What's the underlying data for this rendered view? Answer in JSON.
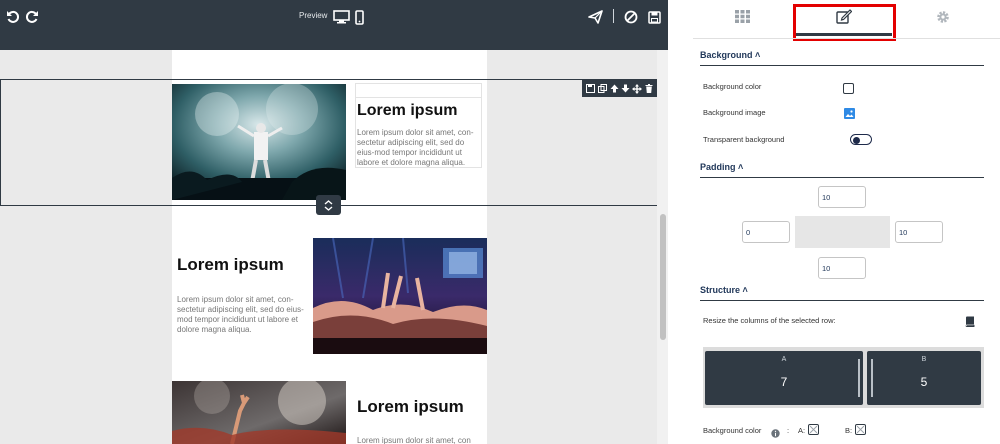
{
  "toolbar": {
    "preview_label": "Preview",
    "icons": [
      "undo-icon",
      "redo-icon",
      "desktop-icon",
      "mobile-icon",
      "send-icon",
      "block-icon",
      "save-icon"
    ]
  },
  "row_toolbar": {
    "icons": [
      "save-icon",
      "copy-icon",
      "arrow-up-icon",
      "arrow-down-icon",
      "move-icon",
      "trash-icon"
    ]
  },
  "content": {
    "blocks": [
      {
        "title": "Lorem ipsum",
        "body": "Lorem ipsum dolor sit amet, con-sectetur adipiscing elit, sed do eius-mod tempor incididunt ut labore et dolore magna aliqua."
      },
      {
        "title": "Lorem ipsum",
        "body": "Lorem ipsum dolor sit amet, con-sectetur adipiscing elit, sed do eius-mod tempor incididunt ut labore et dolore magna aliqua."
      },
      {
        "title": "Lorem ipsum",
        "body": "Lorem ipsum dolor sit amet, con"
      }
    ]
  },
  "panel": {
    "tabs": [
      "blocks-tab",
      "edit-tab",
      "settings-tab"
    ],
    "active_tab": "edit-tab",
    "background": {
      "title": "Background",
      "color_label": "Background color",
      "image_label": "Background image",
      "transparent_label": "Transparent background",
      "transparent_on": true
    },
    "padding": {
      "title": "Padding",
      "top": "10",
      "left": "0",
      "right": "10",
      "bottom": "10"
    },
    "structure": {
      "title": "Structure",
      "resize_label": "Resize the columns of the selected row:",
      "columns": [
        {
          "letter": "A",
          "value": "7"
        },
        {
          "letter": "B",
          "value": "5"
        }
      ],
      "bg_color_label": "Background color",
      "a_label": "A:",
      "b_label": "B:",
      "colon": ":"
    }
  },
  "colors": {
    "topbar": "#303a44",
    "highlight": "#e30000",
    "accent": "#1f3658"
  }
}
